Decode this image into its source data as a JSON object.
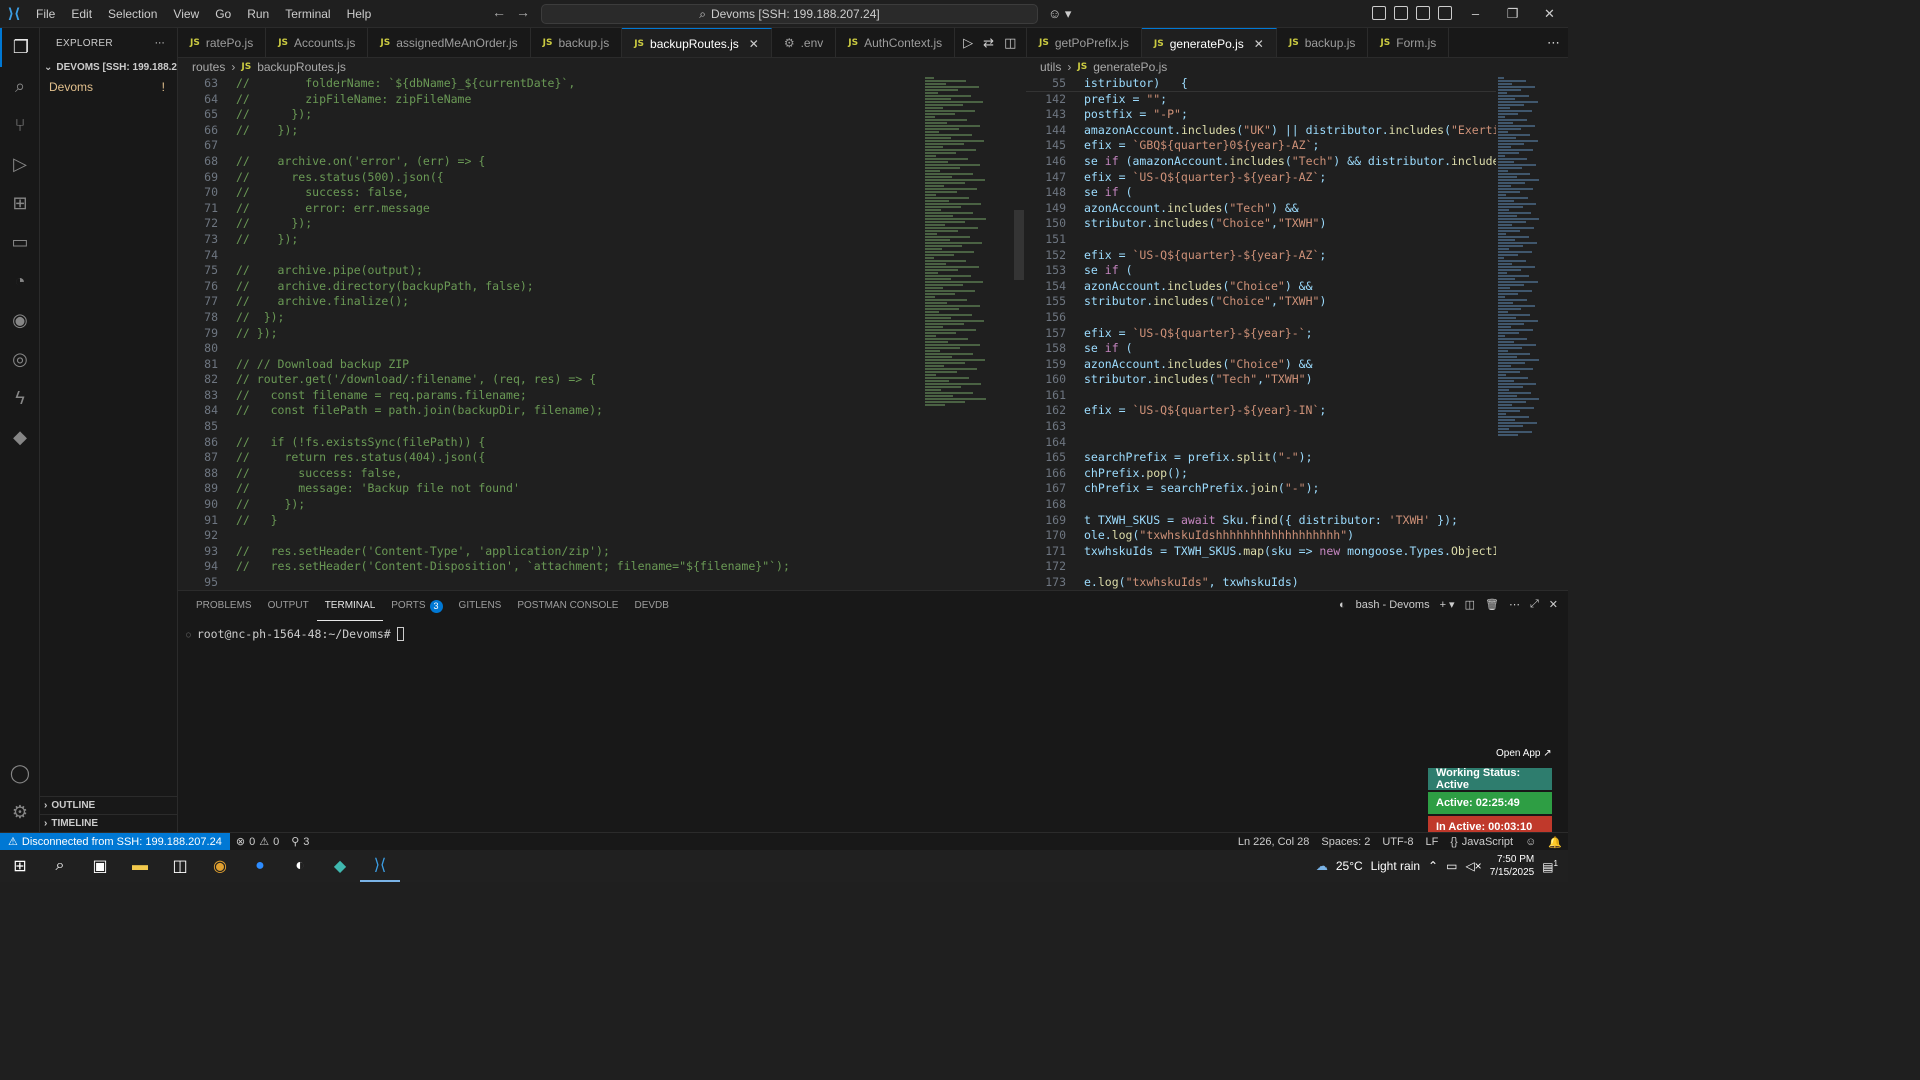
{
  "menu": [
    "File",
    "Edit",
    "Selection",
    "View",
    "Go",
    "Run",
    "Terminal",
    "Help"
  ],
  "command_center": "Devoms [SSH: 199.188.207.24]",
  "sidebar": {
    "title": "EXPLORER",
    "folder": "DEVOMS [SSH: 199.188.20...",
    "item": "Devoms",
    "item_badge": "!",
    "outline": "OUTLINE",
    "timeline": "TIMELINE"
  },
  "left_tabs": [
    {
      "label": "ratePo.js",
      "active": false
    },
    {
      "label": "Accounts.js",
      "active": false
    },
    {
      "label": "assignedMeAnOrder.js",
      "active": false
    },
    {
      "label": "backup.js",
      "active": false
    },
    {
      "label": "backupRoutes.js",
      "active": true
    },
    {
      "label": ".env",
      "active": false,
      "gear": true
    },
    {
      "label": "AuthContext.js",
      "active": false
    }
  ],
  "right_tabs": [
    {
      "label": "getPoPrefix.js",
      "active": false
    },
    {
      "label": "generatePo.js",
      "active": true
    },
    {
      "label": "backup.js",
      "active": false
    },
    {
      "label": "Form.js",
      "active": false
    }
  ],
  "left_breadcrumb": {
    "folder": "routes",
    "file": "backupRoutes.js"
  },
  "right_breadcrumb": {
    "folder": "utils",
    "file": "generatePo.js"
  },
  "left_code_start": 63,
  "left_code": [
    "//        folderName: `${dbName}_${currentDate}`,",
    "//        zipFileName: zipFileName",
    "//      });",
    "//    });",
    "",
    "//    archive.on('error', (err) => {",
    "//      res.status(500).json({",
    "//        success: false,",
    "//        error: err.message",
    "//      });",
    "//    });",
    "",
    "//    archive.pipe(output);",
    "//    archive.directory(backupPath, false);",
    "//    archive.finalize();",
    "//  });",
    "// });",
    "",
    "// // Download backup ZIP",
    "// router.get('/download/:filename', (req, res) => {",
    "//   const filename = req.params.filename;",
    "//   const filePath = path.join(backupDir, filename);",
    "",
    "//   if (!fs.existsSync(filePath)) {",
    "//     return res.status(404).json({",
    "//       success: false,",
    "//       message: 'Backup file not found'",
    "//     });",
    "//   }",
    "",
    "//   res.setHeader('Content-Type', 'application/zip');",
    "//   res.setHeader('Content-Disposition', `attachment; filename=\"${filename}\"`);",
    ""
  ],
  "right_sticky": {
    "num": "55",
    "text": "istributor)   {"
  },
  "right_code": [
    {
      "n": "142",
      "t": "prefix = \"\";"
    },
    {
      "n": "143",
      "t": "postfix = \"-P\";"
    },
    {
      "n": "144",
      "t": "amazonAccount.includes(\"UK\") || distributor.includes(\"Exertis\")) {"
    },
    {
      "n": "145",
      "t": "efix = `GBQ${quarter}0${year}-AZ`;"
    },
    {
      "n": "146",
      "t": "se if (amazonAccount.includes(\"Tech\") && distributor.includes(\"Tec"
    },
    {
      "n": "147",
      "t": "efix = `US-Q${quarter}-${year}-AZ`;"
    },
    {
      "n": "148",
      "t": "se if ("
    },
    {
      "n": "149",
      "t": "azonAccount.includes(\"Tech\") &&"
    },
    {
      "n": "150",
      "t": "stributor.includes(\"Choice\",\"TXWH\")"
    },
    {
      "n": "151",
      "t": ""
    },
    {
      "n": "152",
      "t": "efix = `US-Q${quarter}-${year}-AZ`;"
    },
    {
      "n": "153",
      "t": "se if ("
    },
    {
      "n": "154",
      "t": "azonAccount.includes(\"Choice\") &&"
    },
    {
      "n": "155",
      "t": "stributor.includes(\"Choice\",\"TXWH\")"
    },
    {
      "n": "156",
      "t": ""
    },
    {
      "n": "157",
      "t": "efix = `US-Q${quarter}-${year}-`;"
    },
    {
      "n": "158",
      "t": "se if ("
    },
    {
      "n": "159",
      "t": "azonAccount.includes(\"Choice\") &&"
    },
    {
      "n": "160",
      "t": "stributor.includes(\"Tech\",\"TXWH\")"
    },
    {
      "n": "161",
      "t": ""
    },
    {
      "n": "162",
      "t": "efix = `US-Q${quarter}-${year}-IN`;"
    },
    {
      "n": "163",
      "t": ""
    },
    {
      "n": "164",
      "t": ""
    },
    {
      "n": "165",
      "t": "searchPrefix = prefix.split(\"-\");"
    },
    {
      "n": "166",
      "t": "chPrefix.pop();"
    },
    {
      "n": "167",
      "t": "chPrefix = searchPrefix.join(\"-\");"
    },
    {
      "n": "168",
      "t": ""
    },
    {
      "n": "169",
      "t": "t TXWH_SKUS = await Sku.find({ distributor: 'TXWH' });"
    },
    {
      "n": "170",
      "t": "ole.log(\"txwhskuIdshhhhhhhhhhhhhhhhhh\")"
    },
    {
      "n": "171",
      "t": "txwhskuIds = TXWH_SKUS.map(sku => new mongoose.Types.ObjectId(sku."
    },
    {
      "n": "172",
      "t": ""
    },
    {
      "n": "173",
      "t": "e.log(\"txwhskuIds\", txwhskuIds)"
    }
  ],
  "panel_tabs": [
    {
      "label": "PROBLEMS",
      "active": false
    },
    {
      "label": "OUTPUT",
      "active": false
    },
    {
      "label": "TERMINAL",
      "active": true
    },
    {
      "label": "PORTS",
      "active": false,
      "badge": "3"
    },
    {
      "label": "GITLENS",
      "active": false
    },
    {
      "label": "POSTMAN CONSOLE",
      "active": false
    },
    {
      "label": "DEVDB",
      "active": false
    }
  ],
  "terminal_name": "bash - Devoms",
  "terminal_prompt": "root@nc-ph-1564-48:~/Devoms#",
  "tracker": {
    "open_app": "Open App ↗",
    "status": "Working Status: Active",
    "active": "Active: 02:25:49",
    "inactive": "In Active: 00:03:10",
    "colors": {
      "status": "#2e7d6e",
      "active": "#2e9e44",
      "inactive": "#c0392b"
    }
  },
  "statusbar": {
    "remote": "Disconnected from SSH: 199.188.207.24",
    "errors": "0",
    "warnings": "0",
    "ports": "3",
    "position": "Ln 226, Col 28",
    "spaces": "Spaces: 2",
    "encoding": "UTF-8",
    "eol": "LF",
    "language": "JavaScript"
  },
  "taskbar": {
    "weather_temp": "25°C",
    "weather_desc": "Light rain",
    "time": "7:50 PM",
    "date": "7/15/2025",
    "notif": "1"
  }
}
